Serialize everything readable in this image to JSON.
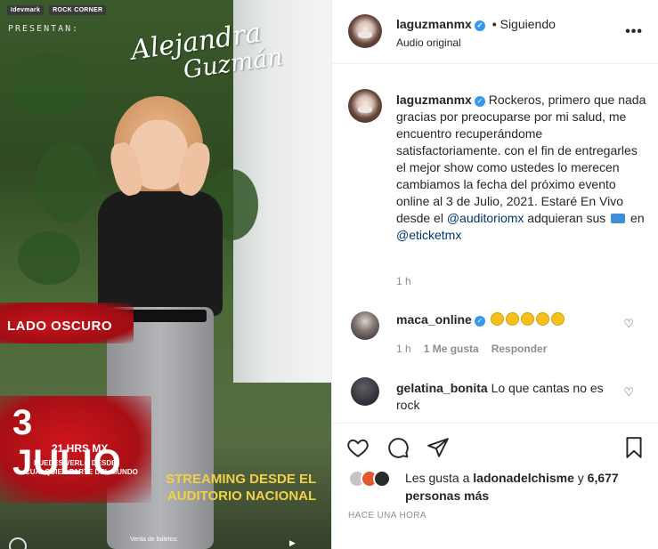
{
  "media": {
    "brand_1": "Idevmark",
    "brand_2": "ROCK CORNER",
    "presentan": "PRESENTAN:",
    "signature_line1": "Alejandra",
    "signature_line2": "Guzmán",
    "lado_oscuro": "LADO OSCURO",
    "date_big": "3 JULIO",
    "date_hours": "21 HRS MX",
    "date_sub1": "PUEDES VERLO DESDE",
    "date_sub2": "CUALQUIER PARTE DEL MUNDO",
    "streaming_line1": "STREAMING DESDE EL",
    "streaming_line2": "AUDITORIO NACIONAL",
    "boletos": "Venta de boletos:"
  },
  "header": {
    "username": "laguzmanmx",
    "separator": "•",
    "follow_status": "Siguiendo",
    "audio": "Audio original",
    "more": "•••"
  },
  "caption": {
    "username": "laguzmanmx",
    "text_part1": "Rockeros, primero que nada gracias por preocuparse por mi salud, me encuentro recuperándome satisfactoriamente. con el fin de entregarles el mejor show como ustedes lo merecen cambiamos la fecha del próximo evento online al 3 de Julio, 2021. Estaré En Vivo desde el",
    "mention1": "@auditoriomx",
    "text_part2": "adquieran sus",
    "text_part3": "en",
    "mention2": "@eticketmx",
    "time": "1 h"
  },
  "comments": [
    {
      "username": "maca_online",
      "text": "",
      "time": "1 h",
      "likes": "1 Me gusta",
      "reply": "Responder"
    },
    {
      "username": "gelatina_bonita",
      "text": "Lo que cantas no es rock"
    }
  ],
  "likes": {
    "prefix": "Les gusta a",
    "user": "ladonadelchisme",
    "connector": "y",
    "others": "6,677 personas más"
  },
  "posted": "HACE UNA HORA",
  "colors": {
    "verified": "#3897f0",
    "mention": "#00376b",
    "meta": "#8e8e8e",
    "accent_red": "#c8141b",
    "accent_yellow": "#f2d146"
  }
}
